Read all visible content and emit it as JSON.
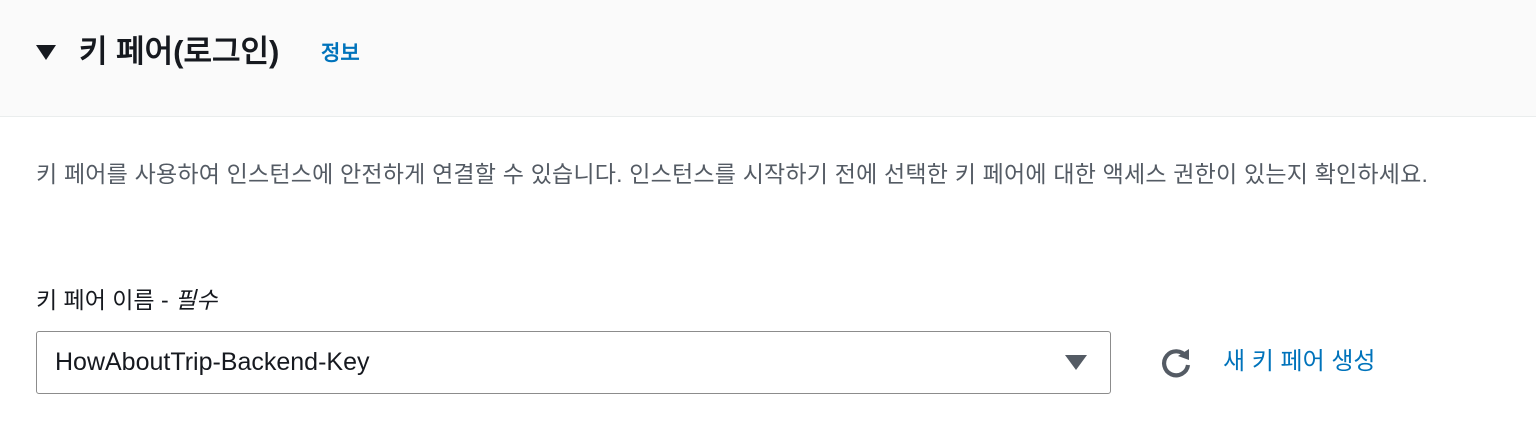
{
  "section": {
    "title": "키 페어(로그인)",
    "info_link": "정보",
    "description": "키 페어를 사용하여 인스턴스에 안전하게 연결할 수 있습니다. 인스턴스를 시작하기 전에 선택한 키 페어에 대한 액세스 권한이 있는지 확인하세요."
  },
  "key_pair_field": {
    "label": "키 페어 이름 - ",
    "required_text": "필수",
    "selected_value": "HowAboutTrip-Backend-Key"
  },
  "actions": {
    "refresh_icon": "refresh-icon",
    "create_new_label": "새 키 페어 생성"
  },
  "colors": {
    "link": "#0073bb",
    "header_bg": "#fafafa",
    "text_primary": "#16191f",
    "text_secondary": "#545b64"
  }
}
